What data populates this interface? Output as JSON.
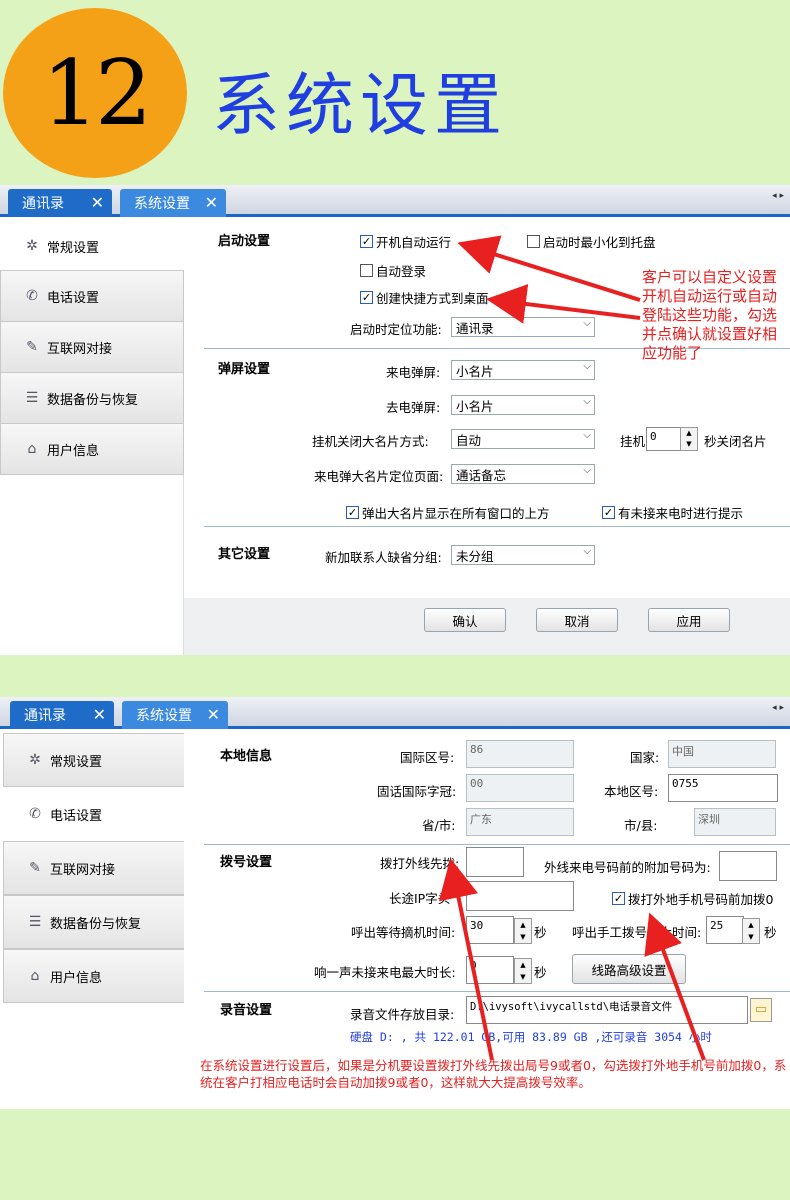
{
  "header": {
    "badge": "12",
    "title": "系统设置"
  },
  "tabs": [
    {
      "label": "通讯录",
      "close": "✕"
    },
    {
      "label": "系统设置",
      "close": "✕"
    }
  ],
  "tab_scroll": "◂ ▸",
  "sidebar": [
    {
      "label": "常规设置",
      "icon": "gear-icon"
    },
    {
      "label": "电话设置",
      "icon": "phone-icon"
    },
    {
      "label": "互联网对接",
      "icon": "pencil-icon"
    },
    {
      "label": "数据备份与恢复",
      "icon": "document-icon"
    },
    {
      "label": "用户信息",
      "icon": "home-icon"
    }
  ],
  "win1": {
    "startup": {
      "title": "启动设置",
      "auto_run": "开机自动运行",
      "minimize": "启动时最小化到托盘",
      "auto_login": "自动登录",
      "shortcut": "创建快捷方式到桌面",
      "locate_label": "启动时定位功能:",
      "locate_value": "通讯录"
    },
    "popup": {
      "title": "弹屏设置",
      "incoming_label": "来电弹屏:",
      "incoming_value": "小名片",
      "outgoing_label": "去电弹屏:",
      "outgoing_value": "小名片",
      "close_label": "挂机关闭大名片方式:",
      "close_value": "自动",
      "hangup_label": "挂机",
      "hangup_value": "0",
      "hangup_suffix": "秒关闭名片",
      "page_label": "来电弹大名片定位页面:",
      "page_value": "通话备忘",
      "on_top": "弹出大名片显示在所有窗口的上方",
      "missed": "有未接来电时进行提示"
    },
    "other": {
      "title": "其它设置",
      "group_label": "新加联系人缺省分组:",
      "group_value": "未分组"
    },
    "buttons": {
      "ok": "确认",
      "cancel": "取消",
      "apply": "应用"
    },
    "note": "客户可以自定义设置开机自动运行或自动登陆这些功能，勾选并点确认就设置好相应功能了"
  },
  "win2": {
    "local": {
      "title": "本地信息",
      "country_code_label": "国际区号:",
      "country_code": "86",
      "country_label": "国家:",
      "country": "中国",
      "prefix_label": "固话国际字冠:",
      "prefix": "00",
      "area_label": "本地区号:",
      "area": "0755",
      "province_label": "省/市:",
      "province": "广东",
      "city_label": "市/县:",
      "city": "深圳"
    },
    "dial": {
      "title": "拨号设置",
      "outside_label": "拨打外线先拨:",
      "extra_label": "外线来电号码前的附加号码为:",
      "ip_label": "长途IP字头",
      "mobile_prefix": "拨打外地手机号码前加拨0",
      "wait_label": "呼出等待摘机时间:",
      "wait_value": "30",
      "wait_unit": "秒",
      "manual_label": "呼出手工拨号最大时间:",
      "manual_value": "25",
      "manual_unit": "秒",
      "ring_label": "响一声未接来电最大时长:",
      "ring_value": "0",
      "ring_unit": "秒",
      "advanced": "线路高级设置"
    },
    "record": {
      "title": "录音设置",
      "dir_label": "录音文件存放目录:",
      "dir_value": "D:\\ivysoft\\ivycallstd\\电话录音文件",
      "disk_info": "硬盘 D: , 共 122.01 GB,可用 83.89 GB ,还可录音 3054 小时"
    },
    "note": "在系统设置进行设置后，如果是分机要设置拨打外线先拨出局号9或者0，勾选拨打外地手机号前加拨0，系统在客户打相应电话时会自动加拨9或者0，这样就大大提高拨号效率。"
  },
  "colors": {
    "accent": "#1f6cc8",
    "note": "#e82020",
    "title": "#1f3fe0",
    "badge": "#f4a118"
  }
}
